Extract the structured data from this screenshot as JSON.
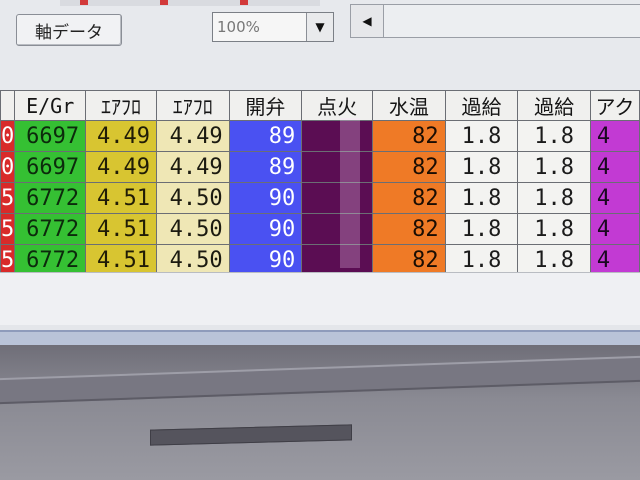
{
  "toolbar": {
    "axis_button_label": "軸データ",
    "zoom_value": "100%",
    "dropdown_arrow": "▼",
    "scroll_left_arrow": "◀"
  },
  "grid": {
    "columns": [
      "E/Gr",
      "ｴｱﾌﾛ",
      "ｴｱﾌﾛ",
      "開弁",
      "点火",
      "水温",
      "過給",
      "過給",
      "アク"
    ],
    "rows": [
      [
        "0",
        "6697",
        "4.49",
        "4.49",
        "89",
        "",
        "82",
        "1.8",
        "1.8",
        "4"
      ],
      [
        "0",
        "6697",
        "4.49",
        "4.49",
        "89",
        "",
        "82",
        "1.8",
        "1.8",
        "4"
      ],
      [
        "5",
        "6772",
        "4.51",
        "4.50",
        "90",
        "",
        "82",
        "1.8",
        "1.8",
        "4"
      ],
      [
        "5",
        "6772",
        "4.51",
        "4.50",
        "90",
        "",
        "82",
        "1.8",
        "1.8",
        "4"
      ],
      [
        "5",
        "6772",
        "4.51",
        "4.50",
        "90",
        "",
        "82",
        "1.8",
        "1.8",
        "4"
      ]
    ]
  },
  "colors": {
    "red": "#d82a2a",
    "green": "#35c033",
    "yellow": "#d8c531",
    "cream": "#efe7b5",
    "blue": "#4a51f2",
    "purple": "#5b0d53",
    "orange": "#ef7a26",
    "white": "#f3f3f1",
    "magenta": "#c23ad3"
  }
}
